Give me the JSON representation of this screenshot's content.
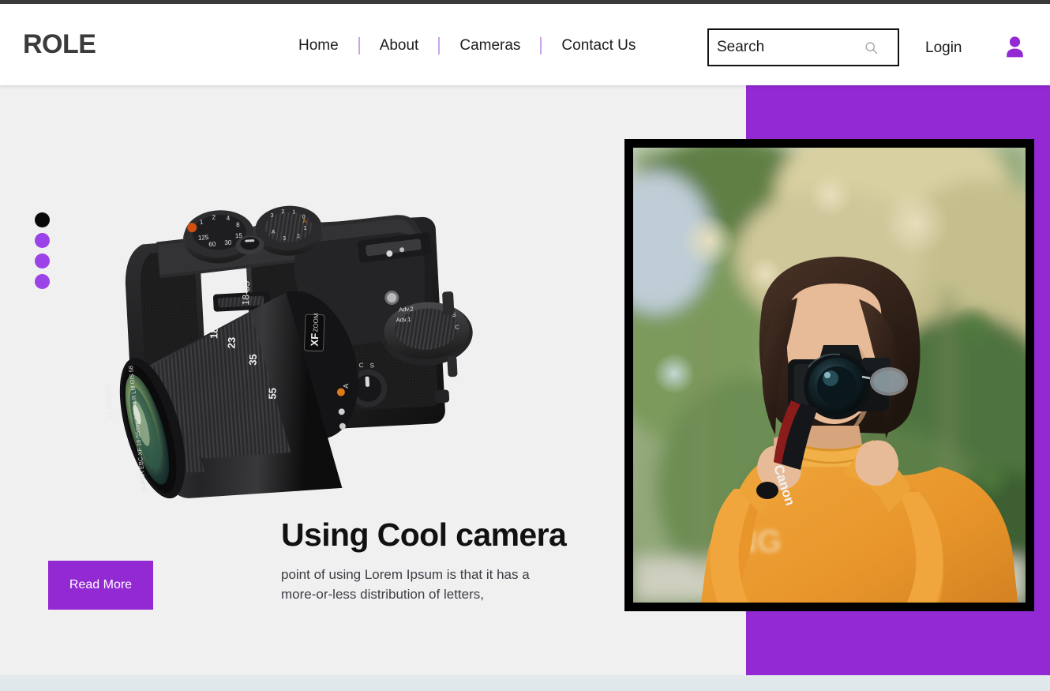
{
  "header": {
    "logo": "ROLE",
    "nav": [
      {
        "label": "Home",
        "name": "home"
      },
      {
        "label": "About",
        "name": "about"
      },
      {
        "label": "Cameras",
        "name": "cameras"
      },
      {
        "label": "Contact Us",
        "name": "contact-us"
      }
    ],
    "search": {
      "placeholder": "Search",
      "value": "",
      "icon": "search-icon"
    },
    "login_label": "Login",
    "account_icon": "user-avatar-icon"
  },
  "hero": {
    "title": "Using Cool camera",
    "paragraph": "point of using Lorem Ipsum is that it has a more-or-less distribution of letters,",
    "read_more_label": "Read More",
    "carousel": {
      "active_index": 0,
      "dots": 4
    },
    "product_image_alt": "black mirrorless camera with 18-55mm zoom lens",
    "photo_alt": "woman in orange sweater taking a photo with a Canon DSLR outdoors",
    "camera_lens_text": "FUJINON",
    "camera_lens_spec": "SUPER EBC XF 18-55mm 1:2.8-4 R LM OIS 58",
    "camera_badge": "XF ZOOM",
    "photo_strap_brand": "Canon"
  },
  "colors": {
    "accent_purple": "#9329d3",
    "dot_purple": "#9c43e8",
    "nav_separator": "#c9a5e8",
    "hero_background": "#f0f0f0",
    "logo_gray": "#3b3b3b",
    "frame_black": "#000000",
    "next_section": "#e3eaec"
  }
}
